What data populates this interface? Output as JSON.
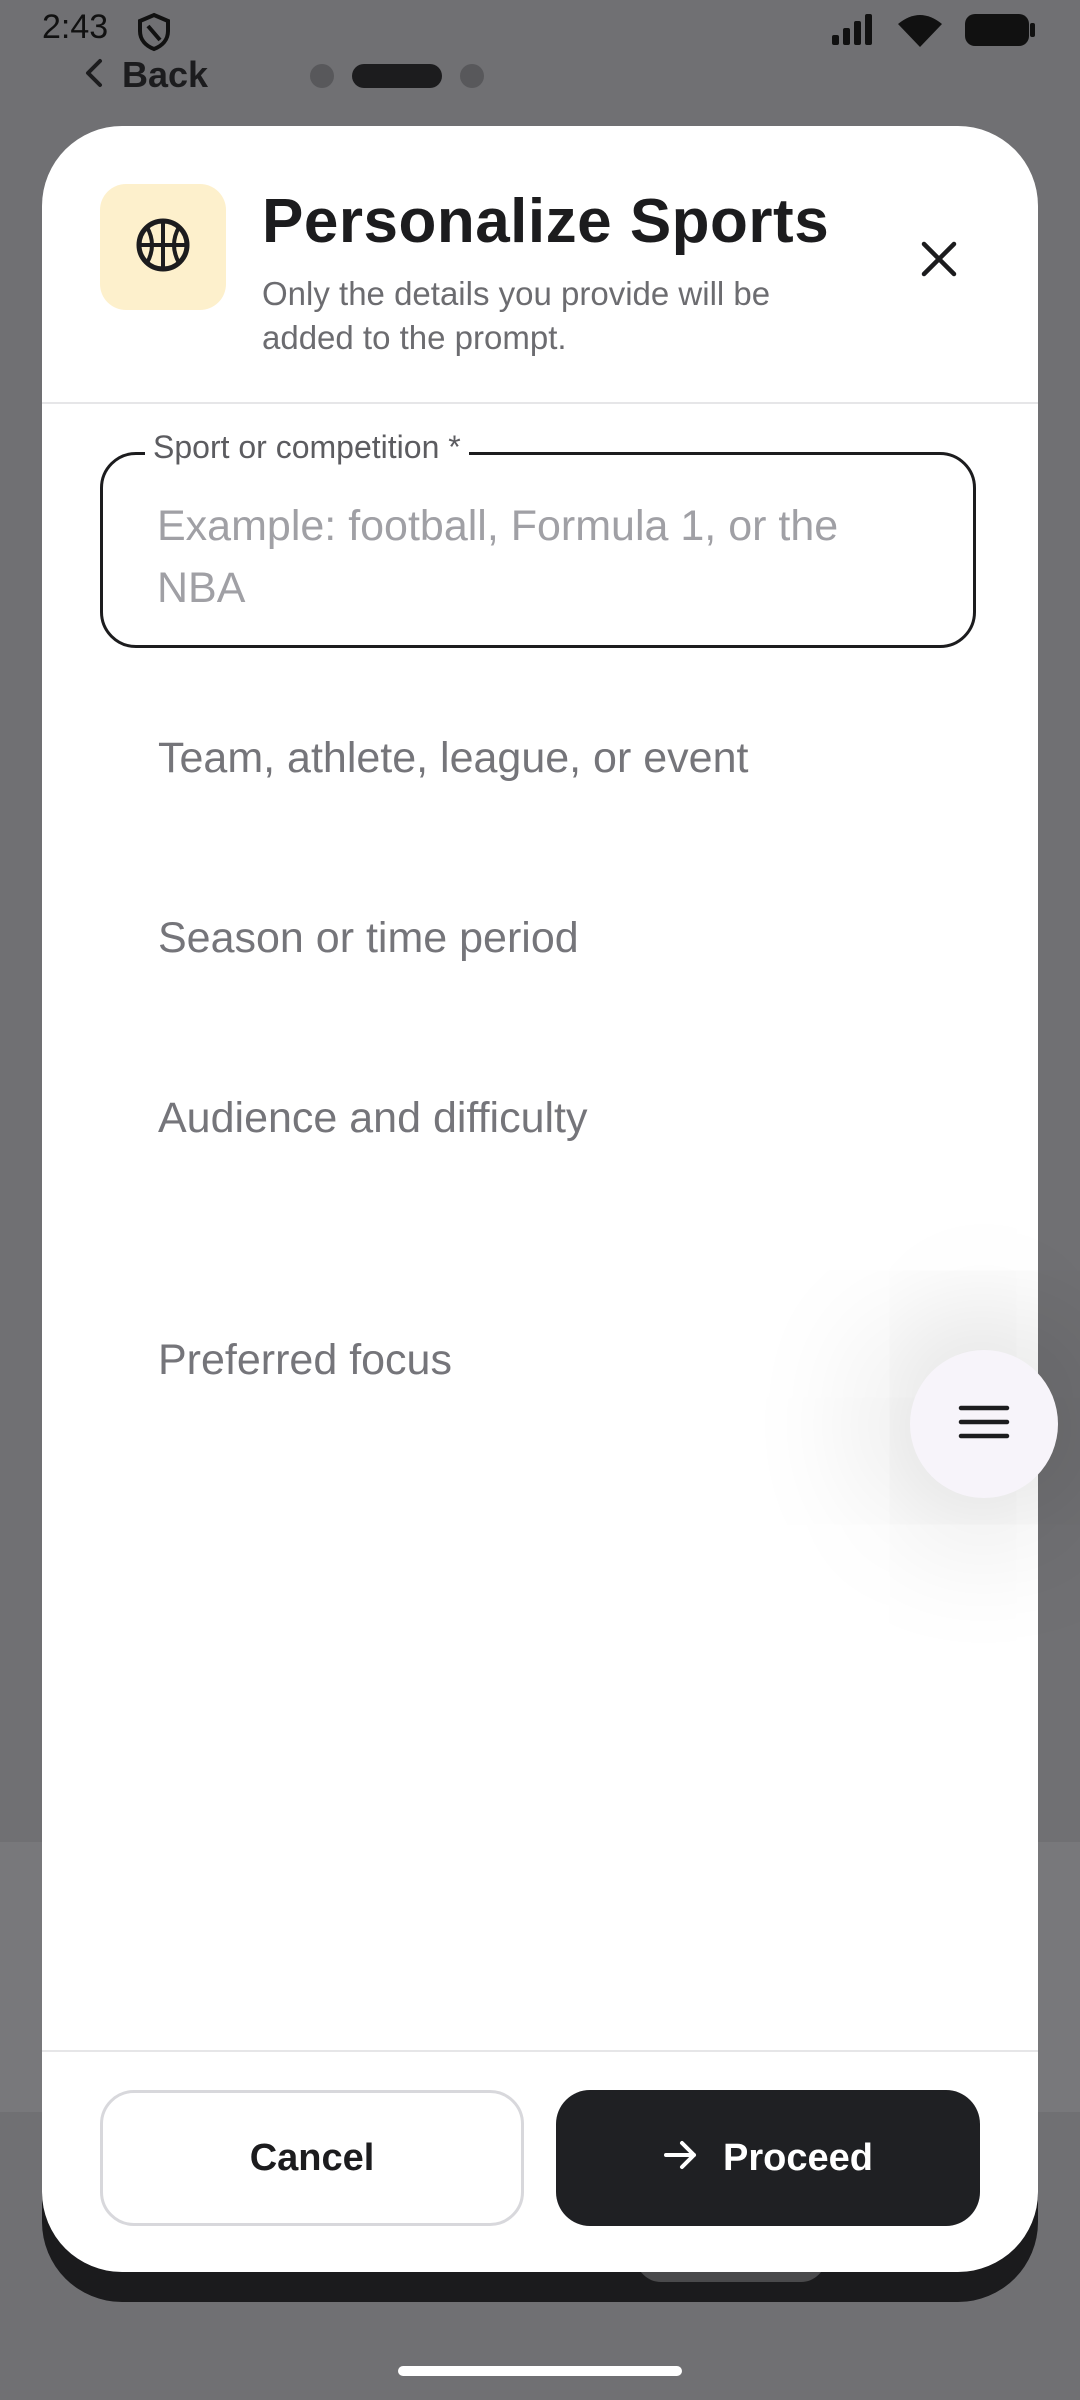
{
  "status_bar": {
    "time": "2:43"
  },
  "nav": {
    "back_label": "Back"
  },
  "modal": {
    "title": "Personalize Sports",
    "subtitle": "Only the details you provide will be added to the prompt.",
    "header_icon": "basketball-icon",
    "accent_tile_color": "#fdf0cc"
  },
  "form": {
    "sport": {
      "label": "Sport or competition *",
      "placeholder": "Example: football, Formula 1, or the NBA"
    },
    "team": {
      "placeholder": "Team, athlete, league, or event"
    },
    "season": {
      "placeholder": "Season or time period"
    },
    "audience": {
      "placeholder": "Audience and difficulty"
    },
    "focus": {
      "placeholder": "Preferred focus"
    }
  },
  "footer": {
    "cancel_label": "Cancel",
    "proceed_label": "Proceed"
  },
  "colors": {
    "primary": "#1f2023",
    "scrim": "#707073"
  }
}
